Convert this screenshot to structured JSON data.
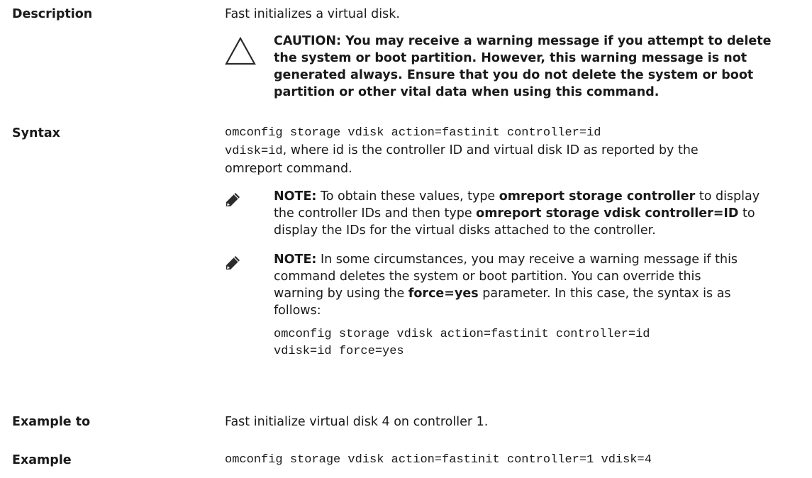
{
  "description": {
    "label": "Description",
    "text": "Fast initializes a virtual disk.",
    "caution_lines": [
      "CAUTION: You may receive a warning message if you attempt to delete",
      "the system or boot partition. However, this warning message is not",
      "generated always. Ensure that you do not delete the system or boot",
      "partition or other vital data when using this command."
    ]
  },
  "syntax": {
    "label": "Syntax",
    "command_line1": "omconfig storage vdisk action=fastinit controller=id",
    "command_line2_code": "vdisk=id",
    "command_line2_text": ", where id is the controller ID and virtual disk ID as reported by the",
    "command_line3": "omreport command.",
    "note1": {
      "prefix": "NOTE:",
      "l1_a": " To obtain these values, type ",
      "l1_b": "omreport storage controller",
      "l1_c": " to display",
      "l2_a": "the controller IDs and then type ",
      "l2_b": "omreport storage vdisk controller=ID",
      "l2_c": " to",
      "l3": "display the IDs for the virtual disks attached to the controller."
    },
    "note2": {
      "prefix": "NOTE:",
      "l1": " In some circumstances, you may receive a warning message if this",
      "l2": "command deletes the system or boot partition. You can override this",
      "l3_a": "warning by using the ",
      "l3_b": "force=yes",
      "l3_c": " parameter. In this case, the syntax is as",
      "l4": "follows:",
      "code1": "omconfig storage vdisk action=fastinit controller=id",
      "code2": "vdisk=id force=yes"
    }
  },
  "example_to": {
    "label": "Example to",
    "text": "Fast initialize virtual disk 4 on controller 1."
  },
  "example": {
    "label": "Example",
    "code": "omconfig storage vdisk action=fastinit controller=1 vdisk=4"
  }
}
